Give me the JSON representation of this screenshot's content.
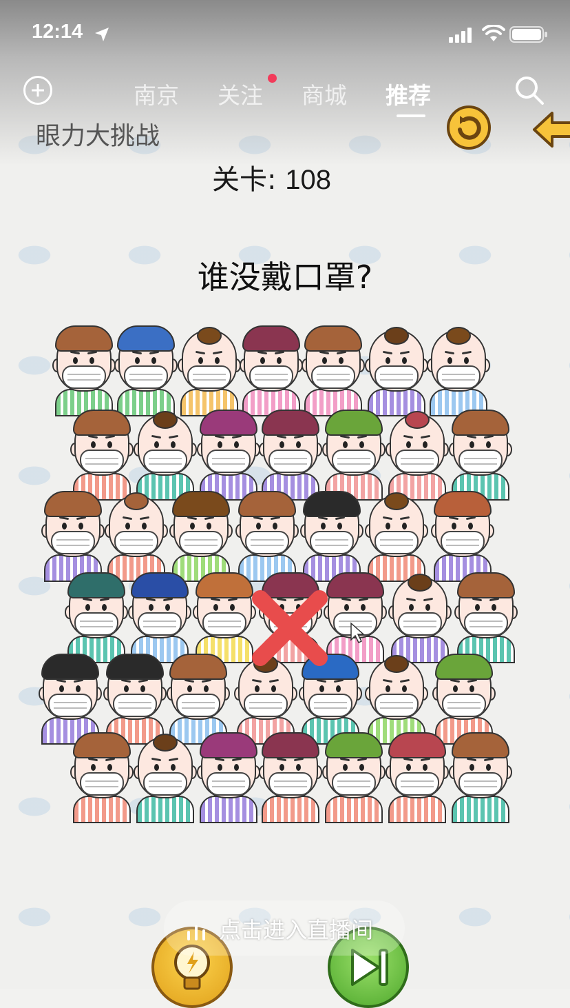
{
  "status_bar": {
    "time": "12:14",
    "icons": [
      "location-arrow-icon",
      "cellular-signal-icon",
      "wifi-icon",
      "battery-icon"
    ]
  },
  "nav": {
    "tabs": [
      {
        "label": "南京",
        "active": false
      },
      {
        "label": "关注",
        "active": false,
        "badge_dot": true
      },
      {
        "label": "商城",
        "active": false
      },
      {
        "label": "推荐",
        "active": true
      }
    ],
    "left_icon": "add-circle-icon",
    "right_icon": "search-icon",
    "badge_color": "#f23b5a"
  },
  "game": {
    "title": "眼力大挑战",
    "level_label": "关卡:",
    "level_number": "108",
    "question": "谁没戴口罩?",
    "refresh_icon": "refresh-icon",
    "back_icon": "back-arrow-icon",
    "wrong_mark_icon": "wrong-x-icon",
    "wrong_mark_color": "#e84c4c"
  },
  "live": {
    "text": "点击进入直播间",
    "icon": "live-bars-icon"
  },
  "bottom_buttons": {
    "hint_icon": "lightbulb-icon",
    "skip_icon": "skip-next-icon"
  }
}
